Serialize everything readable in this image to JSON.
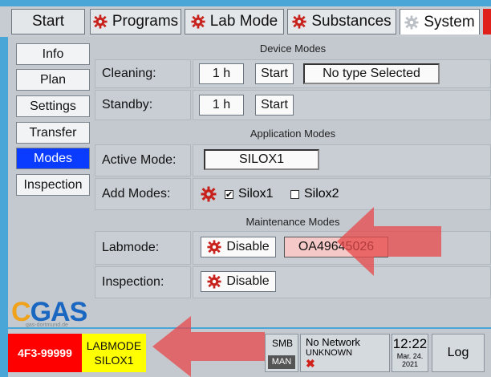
{
  "tabs": [
    {
      "label": "Start",
      "icon": null,
      "active": false
    },
    {
      "label": "Programs",
      "icon": "gear-icon",
      "active": false
    },
    {
      "label": "Lab Mode",
      "icon": "gear-icon",
      "active": false
    },
    {
      "label": "Substances",
      "icon": "gear-icon",
      "active": false
    },
    {
      "label": "System",
      "icon": "gear-icon",
      "active": true
    }
  ],
  "nav": [
    {
      "label": "Info"
    },
    {
      "label": "Plan"
    },
    {
      "label": "Settings"
    },
    {
      "label": "Transfer"
    },
    {
      "label": "Modes",
      "selected": true
    },
    {
      "label": "Inspection"
    }
  ],
  "sections": {
    "device": "Device Modes",
    "application": "Application Modes",
    "maintenance": "Maintenance Modes"
  },
  "rows": {
    "cleaning": {
      "label": "Cleaning:",
      "duration": "1 h",
      "start": "Start",
      "type": "No type Selected"
    },
    "standby": {
      "label": "Standby:",
      "duration": "1 h",
      "start": "Start"
    },
    "active_mode": {
      "label": "Active Mode:",
      "value": "SILOX1"
    },
    "add_modes": {
      "label": "Add Modes:",
      "opt1": "Silox1",
      "opt1_checked": true,
      "opt2": "Silox2",
      "opt2_checked": false
    },
    "labmode": {
      "label": "Labmode:",
      "button": "Disable",
      "code": "OA49645026"
    },
    "inspection": {
      "label": "Inspection:",
      "button": "Disable"
    }
  },
  "logo": {
    "text_c": "C",
    "text_rest": "GAS",
    "sub": "gas-dortmund.de"
  },
  "status": {
    "device_id": "4F3-99999",
    "mode_line1": "LABMODE",
    "mode_line2": "SILOX1",
    "smb": "SMB",
    "man": "MAN",
    "network": "No Network",
    "network_sub": "UNKNOWN",
    "time": "12:22",
    "date1": "Mar. 24.",
    "date2": "2021",
    "log": "Log"
  },
  "colors": {
    "accent_blue": "#0a3cff",
    "alarm_red": "#ff0000",
    "mode_yellow": "#ffff00",
    "gear_red": "#c8201a",
    "arrow_red": "#e8484a"
  }
}
